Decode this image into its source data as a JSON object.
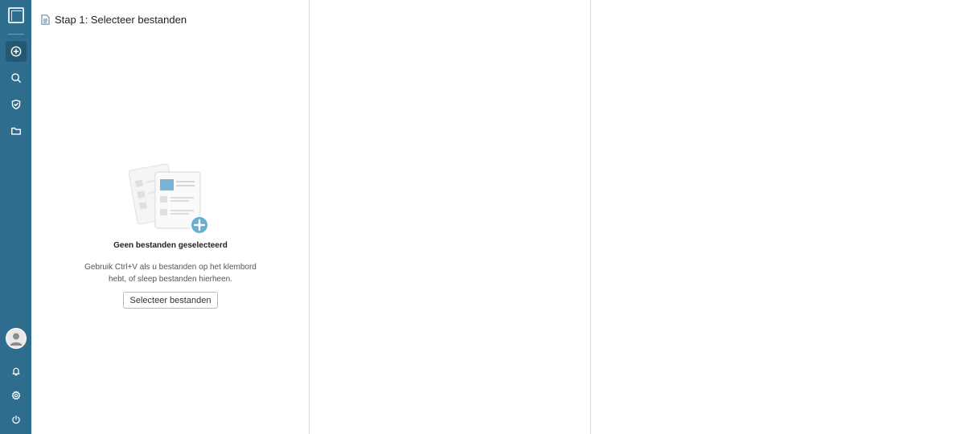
{
  "sidebar": {
    "logo_icon": "app-logo-icon",
    "nav": [
      {
        "name": "add-circle-icon",
        "active": true
      },
      {
        "name": "search-icon",
        "active": false
      },
      {
        "name": "shield-icon",
        "active": false
      },
      {
        "name": "folder-icon",
        "active": false
      }
    ],
    "bottom": [
      {
        "name": "bell-icon"
      },
      {
        "name": "gear-icon"
      },
      {
        "name": "power-icon"
      }
    ]
  },
  "step1": {
    "title": "Stap 1: Selecteer bestanden",
    "empty_title": "Geen bestanden geselecteerd",
    "empty_desc_line1": "Gebruik Ctrl+V als u bestanden op het klembord",
    "empty_desc_line2": "hebt, of sleep bestanden hierheen.",
    "select_button": "Selecteer bestanden"
  },
  "colors": {
    "sidebar_bg": "#2f6d8e",
    "sidebar_active": "#245872",
    "accent": "#6aaed0",
    "divider": "#d9d9d9"
  }
}
